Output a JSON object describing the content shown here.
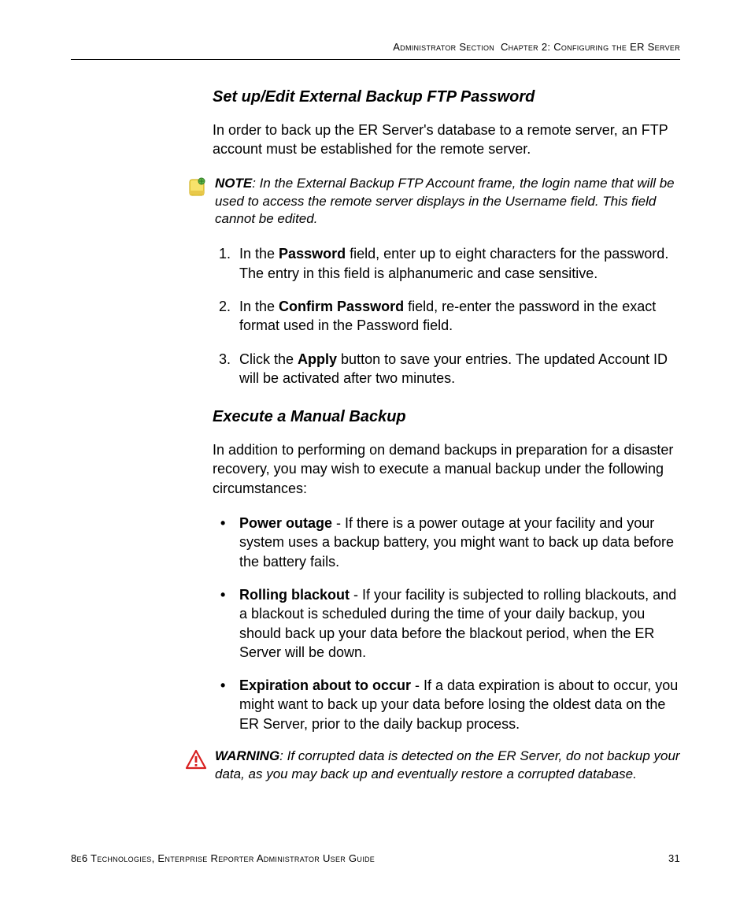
{
  "header": {
    "section": "Administrator Section",
    "chapter": "Chapter 2: Configuring the ER Server"
  },
  "section1": {
    "heading": "Set up/Edit External Backup FTP Password",
    "intro": "In order to back up the ER Server's database to a remote server, an FTP account must be established for the remote server.",
    "note_label": "NOTE",
    "note_text": ": In the External Backup FTP Account frame, the login name that will be used to access the remote server displays in the Username field. This field cannot be edited.",
    "step1_pre": "In the ",
    "step1_bold": "Password",
    "step1_post": " field, enter up to eight characters for the password. The entry in this field is alphanumeric and case sensitive.",
    "step2_pre": "In the ",
    "step2_bold": "Confirm Password",
    "step2_post": " field, re-enter the password in the exact format used in the Password field.",
    "step3_pre": "Click the ",
    "step3_bold": "Apply",
    "step3_post": " button to save your entries. The updated Account ID will be activated after two minutes."
  },
  "section2": {
    "heading": "Execute a Manual Backup",
    "intro": "In addition to performing on demand backups in preparation for a disaster recovery, you may wish to execute a manual backup under the following circumstances:",
    "b1_bold": "Power outage",
    "b1_text": " - If there is a power outage at your facility and your system uses a backup battery, you might want to back up data before the battery fails.",
    "b2_bold": "Rolling blackout",
    "b2_text": " - If your facility is subjected to rolling blackouts, and a blackout is scheduled during the time of your daily backup, you should back up your data before the blackout period, when the ER Server will be down.",
    "b3_bold": "Expiration about to occur",
    "b3_text": " - If a data expiration is about to occur, you might want to back up your data before losing the oldest data on the ER Server, prior to the daily backup process.",
    "warn_label": "WARNING",
    "warn_text": ": If corrupted data is detected on the ER Server, do not backup your data, as you may back up and eventually restore a corrupted database."
  },
  "footer": {
    "left": "8e6 Technologies, Enterprise Reporter Administrator User Guide",
    "page": "31"
  }
}
